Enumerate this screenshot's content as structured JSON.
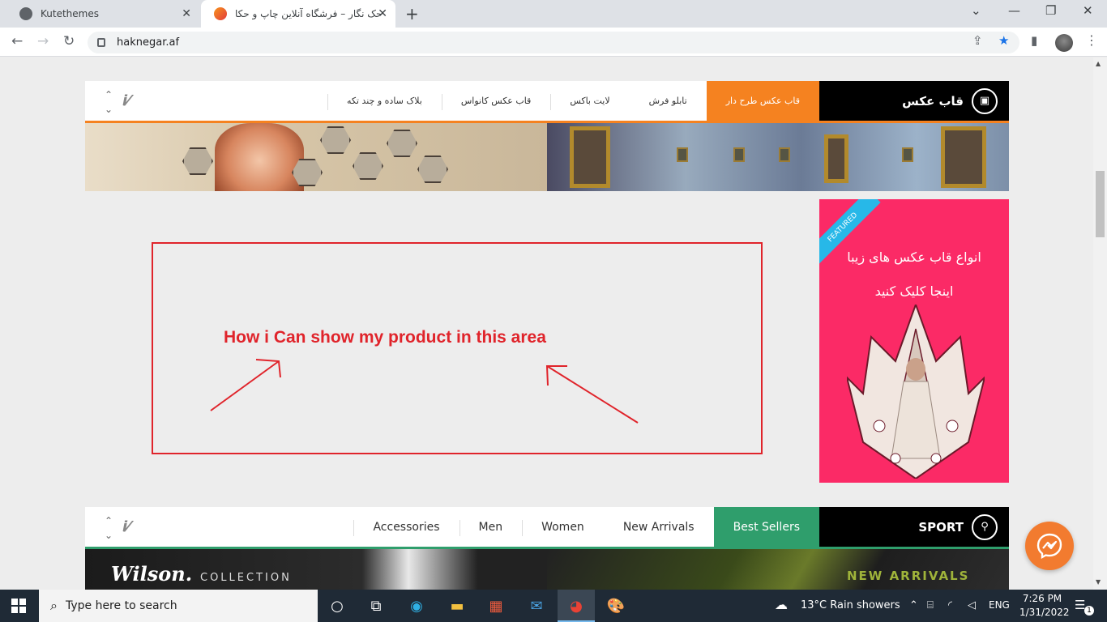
{
  "browser": {
    "tabs": [
      {
        "title": "Kutethemes",
        "close": "✕"
      },
      {
        "title": "حک نگار – فرشگاه آنلاین چاپ و حکا",
        "close": "✕"
      }
    ],
    "new_tab": "+",
    "url": "haknegar.af",
    "window_controls": {
      "dropdown": "⌄",
      "minimize": "—",
      "restore": "❐",
      "close": "✕"
    }
  },
  "site": {
    "section1": {
      "category": "قاب عکس",
      "tabs": [
        "قاب عکس طرح دار",
        "تابلو فرش",
        "لایت باکس",
        "قاب عکس کانواس",
        "بلاک ساده و چند تکه"
      ],
      "active_index": 0
    },
    "promo": {
      "badge": "FEATURED",
      "line1": "انواع قاب عکس های زیبا",
      "line2": "اینجا کلیک کنید",
      "bg_color": "#fb2a66"
    },
    "annotation": {
      "text": "How i Can show my product in this area",
      "color": "#e0242b"
    },
    "section2": {
      "category": "SPORT",
      "tabs": [
        "Best Sellers",
        "New Arrivals",
        "Women",
        "Men",
        "Accessories"
      ],
      "active_index": 0
    },
    "banners": {
      "wilson": "Wilson.",
      "collection": "COLLECTION",
      "new_arrivals": "NEW ARRIVALS"
    }
  },
  "taskbar": {
    "search_placeholder": "Type here to search",
    "weather": "13°C  Rain showers",
    "lang": "ENG",
    "time": "7:26 PM",
    "date": "1/31/2022",
    "notification_count": "1"
  },
  "icons": {
    "arrows_updown": "⌃⌄",
    "brand_mark": "i⁄"
  },
  "colors": {
    "section1_accent": "#f58220",
    "section2_accent": "#2f9e6c",
    "messenger": "#f27b2f"
  }
}
